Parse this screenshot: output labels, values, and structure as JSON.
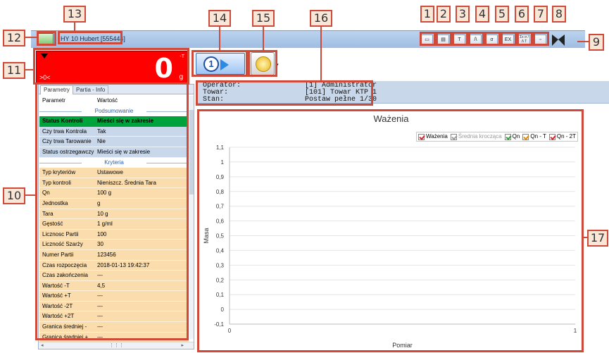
{
  "titlebar": {
    "title": "HY 10 Hubert [555444]"
  },
  "toolbar_buttons": [
    "T",
    "/\\",
    "σ",
    "EX",
    "Σx σ / Λ T"
  ],
  "scale": {
    "value": "0",
    "unit": "g",
    "tare_indicator": "-T",
    "zero_label": ">0<"
  },
  "start_button": {
    "label": "1"
  },
  "info": {
    "operator_label": "Operator:",
    "operator_value": "[1] Administrator",
    "towar_label": "Towar:",
    "towar_value": "[101] Towar KTP 1",
    "stan_label": "Stan:",
    "stan_value": "Postaw pełne 1/30"
  },
  "tabs": [
    "Parametry",
    "Partia - Info"
  ],
  "grid": {
    "header": [
      "Parametr",
      "Wartość"
    ],
    "section_summary": "Podsumowanie",
    "summary_rows": [
      {
        "name": "Status Kontroli",
        "value": "Mieści się w zakresie",
        "style": "green"
      },
      {
        "name": "Czy trwa Kontrola",
        "value": "Tak",
        "style": "blue"
      },
      {
        "name": "Czy trwa Tarowanie",
        "value": "Nie",
        "style": "blue"
      },
      {
        "name": "Status ostrzegawczy",
        "value": "Mieści się w zakresie",
        "style": "blue"
      }
    ],
    "section_criteria": "Kryteria",
    "criteria_rows": [
      {
        "name": "Typ kryteriów",
        "value": "Ustawowe"
      },
      {
        "name": "Typ kontroli",
        "value": "Nieniszcz. Średnia Tara"
      },
      {
        "name": "Qn",
        "value": "100 g"
      },
      {
        "name": "Jednostka",
        "value": "g"
      },
      {
        "name": "Tara",
        "value": "10 g"
      },
      {
        "name": "Gęstość",
        "value": "1 g/ml"
      },
      {
        "name": "Licznosc Partii",
        "value": "100"
      },
      {
        "name": "Liczność Szarży",
        "value": "30"
      },
      {
        "name": "Numer Partii",
        "value": "123456"
      },
      {
        "name": "Czas rozpoczęcia",
        "value": "2018-01-13 19:42:37"
      },
      {
        "name": "Czas zakończenia",
        "value": "---"
      },
      {
        "name": "Wartość -T",
        "value": "4,5"
      },
      {
        "name": "Wartość +T",
        "value": "---"
      },
      {
        "name": "Wartość -2T",
        "value": "---"
      },
      {
        "name": "Wartość +2T",
        "value": "---"
      },
      {
        "name": "Granica średniej -",
        "value": "---"
      },
      {
        "name": "Granica średniej +",
        "value": "---"
      }
    ]
  },
  "callouts": [
    "1",
    "2",
    "3",
    "4",
    "5",
    "6",
    "7",
    "8",
    "9",
    "10",
    "11",
    "12",
    "13",
    "14",
    "15",
    "16",
    "17"
  ],
  "chart_data": {
    "type": "line",
    "title": "Ważenia",
    "xlabel": "Pomiar",
    "ylabel": "Masa",
    "xlim": [
      0,
      1
    ],
    "ylim": [
      -0.1,
      1.1
    ],
    "yticks": [
      "1,1",
      "1",
      "0,9",
      "0,8",
      "0,7",
      "0,6",
      "0,5",
      "0,4",
      "0,3",
      "0,2",
      "0,1",
      "0",
      "-0,1"
    ],
    "xticks": [
      "0",
      "1"
    ],
    "grid": true,
    "legend_position": "top-right",
    "series": [
      {
        "name": "Ważenia",
        "values": [],
        "checked": true,
        "color": "#d62728"
      },
      {
        "name": "Średnia krocząca",
        "values": [],
        "checked": true,
        "color": "#9a9a9a"
      },
      {
        "name": "Qn",
        "values": [],
        "checked": true,
        "color": "#2ca02c"
      },
      {
        "name": "Qn - T",
        "values": [],
        "checked": true,
        "color": "#e08a00"
      },
      {
        "name": "Qn - 2T",
        "values": [],
        "checked": true,
        "color": "#d62728"
      }
    ]
  }
}
